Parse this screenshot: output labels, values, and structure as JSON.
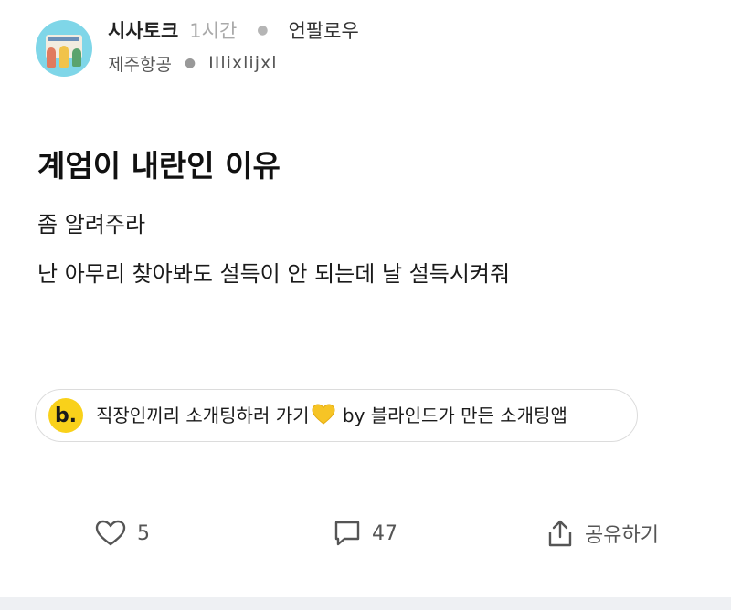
{
  "post": {
    "board_name": "시사토크",
    "time_ago": "1시간",
    "follow_label": "언팔로우",
    "company": "제주항공",
    "nickname": "IIlixlijxl",
    "title": "계엄이 내란인 이유",
    "body_lines": [
      "좀 알려주라",
      "난 아무리 찾아봐도 설득이 안 되는데 날 설득시켜줘"
    ]
  },
  "ad_banner": {
    "logo_text": "b.",
    "text_before": "직장인끼리 소개팅하러 가기",
    "emoji": "yellow-heart-icon",
    "text_after": "by 블라인드가 만든 소개팅앱"
  },
  "actions": {
    "like_count": "5",
    "comment_count": "47",
    "share_label": "공유하기"
  },
  "colors": {
    "accent_yellow": "#f9d11a",
    "avatar_bg": "#7fd6e8",
    "muted_text": "#a9a9a9"
  }
}
